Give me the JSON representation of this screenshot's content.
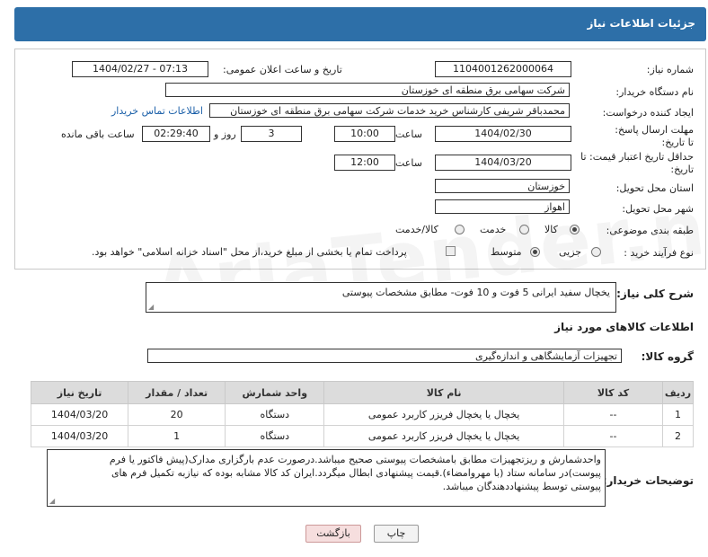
{
  "header": {
    "title": "جزئیات اطلاعات نیاز"
  },
  "form": {
    "need_number_label": "شماره نیاز:",
    "need_number": "1104001262000064",
    "announce_label": "تاریخ و ساعت اعلان عمومی:",
    "announce_value": "1404/02/27 - 07:13",
    "buyer_org_label": "نام دستگاه خریدار:",
    "buyer_org": "شرکت سهامی برق منطقه ای خوزستان",
    "creator_label": "ایجاد کننده درخواست:",
    "creator": "محمدباقر شریفی کارشناس خرید خدمات شرکت سهامی برق منطقه ای خوزستان",
    "contact_link": "اطلاعات تماس خریدار",
    "deadline_label": "مهلت ارسال پاسخ: تا تاریخ:",
    "deadline_date": "1404/02/30",
    "hour_label": "ساعت",
    "deadline_time": "10:00",
    "days_value": "3",
    "days_label": "روز و",
    "remaining_time": "02:29:40",
    "remaining_label": "ساعت باقی مانده",
    "validity_label": "حداقل تاریخ اعتبار قیمت: تا تاریخ:",
    "validity_date": "1404/03/20",
    "validity_time": "12:00",
    "province_label": "استان محل تحویل:",
    "province": "خوزستان",
    "city_label": "شهر محل تحویل:",
    "city": "اهواز",
    "category_label": "طبقه بندی موضوعی:",
    "category_options": [
      "کالا",
      "خدمت",
      "کالا/خدمت"
    ],
    "process_label": "نوع فرآیند خرید :",
    "process_options": [
      "جزیی",
      "متوسط"
    ],
    "payment_note": "پرداخت تمام یا بخشی از مبلغ خرید،از محل \"اسناد خزانه اسلامی\" خواهد بود."
  },
  "summary": {
    "label": "شرح کلی نیاز:",
    "text": "یخچال سفید ایرانی 5 فوت و 10 فوت- مطابق مشخصات پیوستی"
  },
  "goods": {
    "section_title": "اطلاعات کالاهای مورد نیاز",
    "group_label": "گروه کالا:",
    "group_value": "تجهیزات آزمایشگاهی و اندازه‌گیری",
    "columns": [
      "ردیف",
      "کد کالا",
      "نام کالا",
      "واحد شمارش",
      "تعداد / مقدار",
      "تاریخ نیاز"
    ],
    "rows": [
      {
        "row": "1",
        "code": "--",
        "name": "یخچال یا یخچال فریزر کاربرد عمومی",
        "unit": "دستگاه",
        "qty": "20",
        "date": "1404/03/20"
      },
      {
        "row": "2",
        "code": "--",
        "name": "یخچال یا یخچال فریزر کاربرد عمومی",
        "unit": "دستگاه",
        "qty": "1",
        "date": "1404/03/20"
      }
    ]
  },
  "buyer_notes": {
    "label": "توضیحات خریدار:",
    "lines": [
      "واحدشمارش و ریزتجهیزات مطابق بامشخصات پیوستی صحیح میباشد.درصورت عدم بارگزاری مدارک(پیش فاکتور یا فرم",
      "پیوست)در سامانه ستاد (با مهروامضاء).قیمت پیشنهادی ابطال میگردد.ایران کد کالا مشابه بوده که نیازبه تکمیل فرم های",
      "پیوستی توسط پیشنهاددهندگان میباشد."
    ]
  },
  "buttons": {
    "print": "چاپ",
    "back": "بازگشت"
  },
  "watermark": "AriaTender.neT"
}
